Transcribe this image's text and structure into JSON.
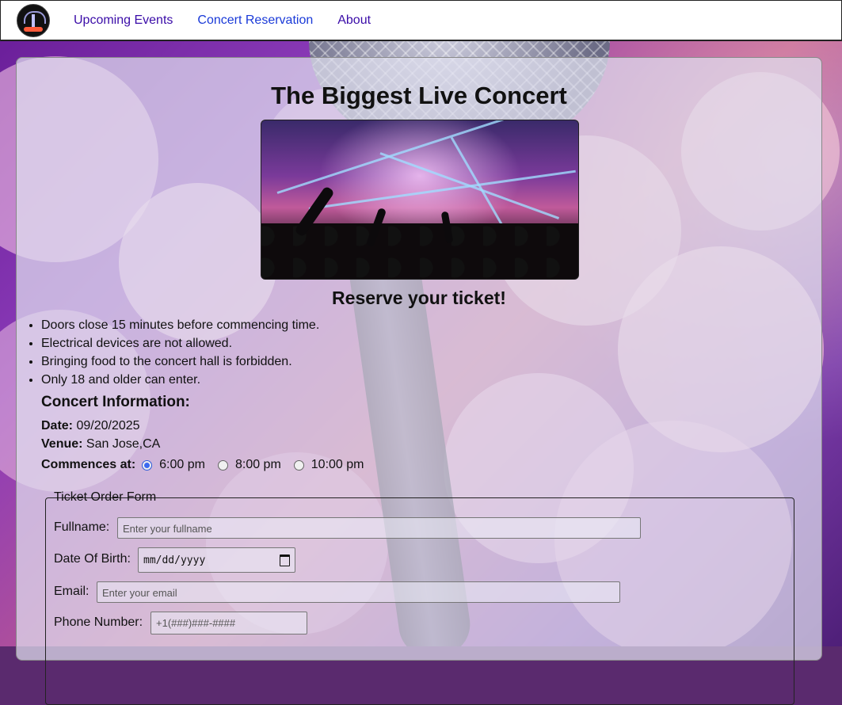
{
  "nav": {
    "logo_icon": "concert-logo-icon",
    "links": [
      "Upcoming Events",
      "Concert Reservation",
      "About"
    ],
    "active_link": "Concert Reservation"
  },
  "main": {
    "title": "The Biggest Live Concert",
    "hero_image": "concert-crowd-image",
    "subtitle": "Reserve your ticket!",
    "rules": [
      "Doors close 15 minutes before commencing time.",
      "Electrical devices are not allowed.",
      "Bringing food to the concert hall is forbidden.",
      "Only 18 and older can enter."
    ]
  },
  "info": {
    "heading": "Concert Information:",
    "date_label": "Date:",
    "date_value": "09/20/2025",
    "venue_label": "Venue:",
    "venue_value": "San Jose,CA",
    "time_label": "Commences at:",
    "time_options": [
      "6:00 pm",
      "8:00 pm",
      "10:00 pm"
    ],
    "selected_time": "6:00 pm"
  },
  "form": {
    "legend": "Ticket Order Form",
    "fullname_label": "Fullname:",
    "fullname_placeholder": "Enter your fullname",
    "dob_label": "Date Of Birth:",
    "dob_placeholder": "mm/dd/yyyy",
    "email_label": "Email:",
    "email_placeholder": "Enter your email",
    "phone_label": "Phone Number:",
    "phone_placeholder": "+1(###)###-####"
  },
  "colors": {
    "nav_link": "#3a0ca8",
    "nav_active": "#1a3ad8",
    "radio_accent": "#3a6af0"
  }
}
